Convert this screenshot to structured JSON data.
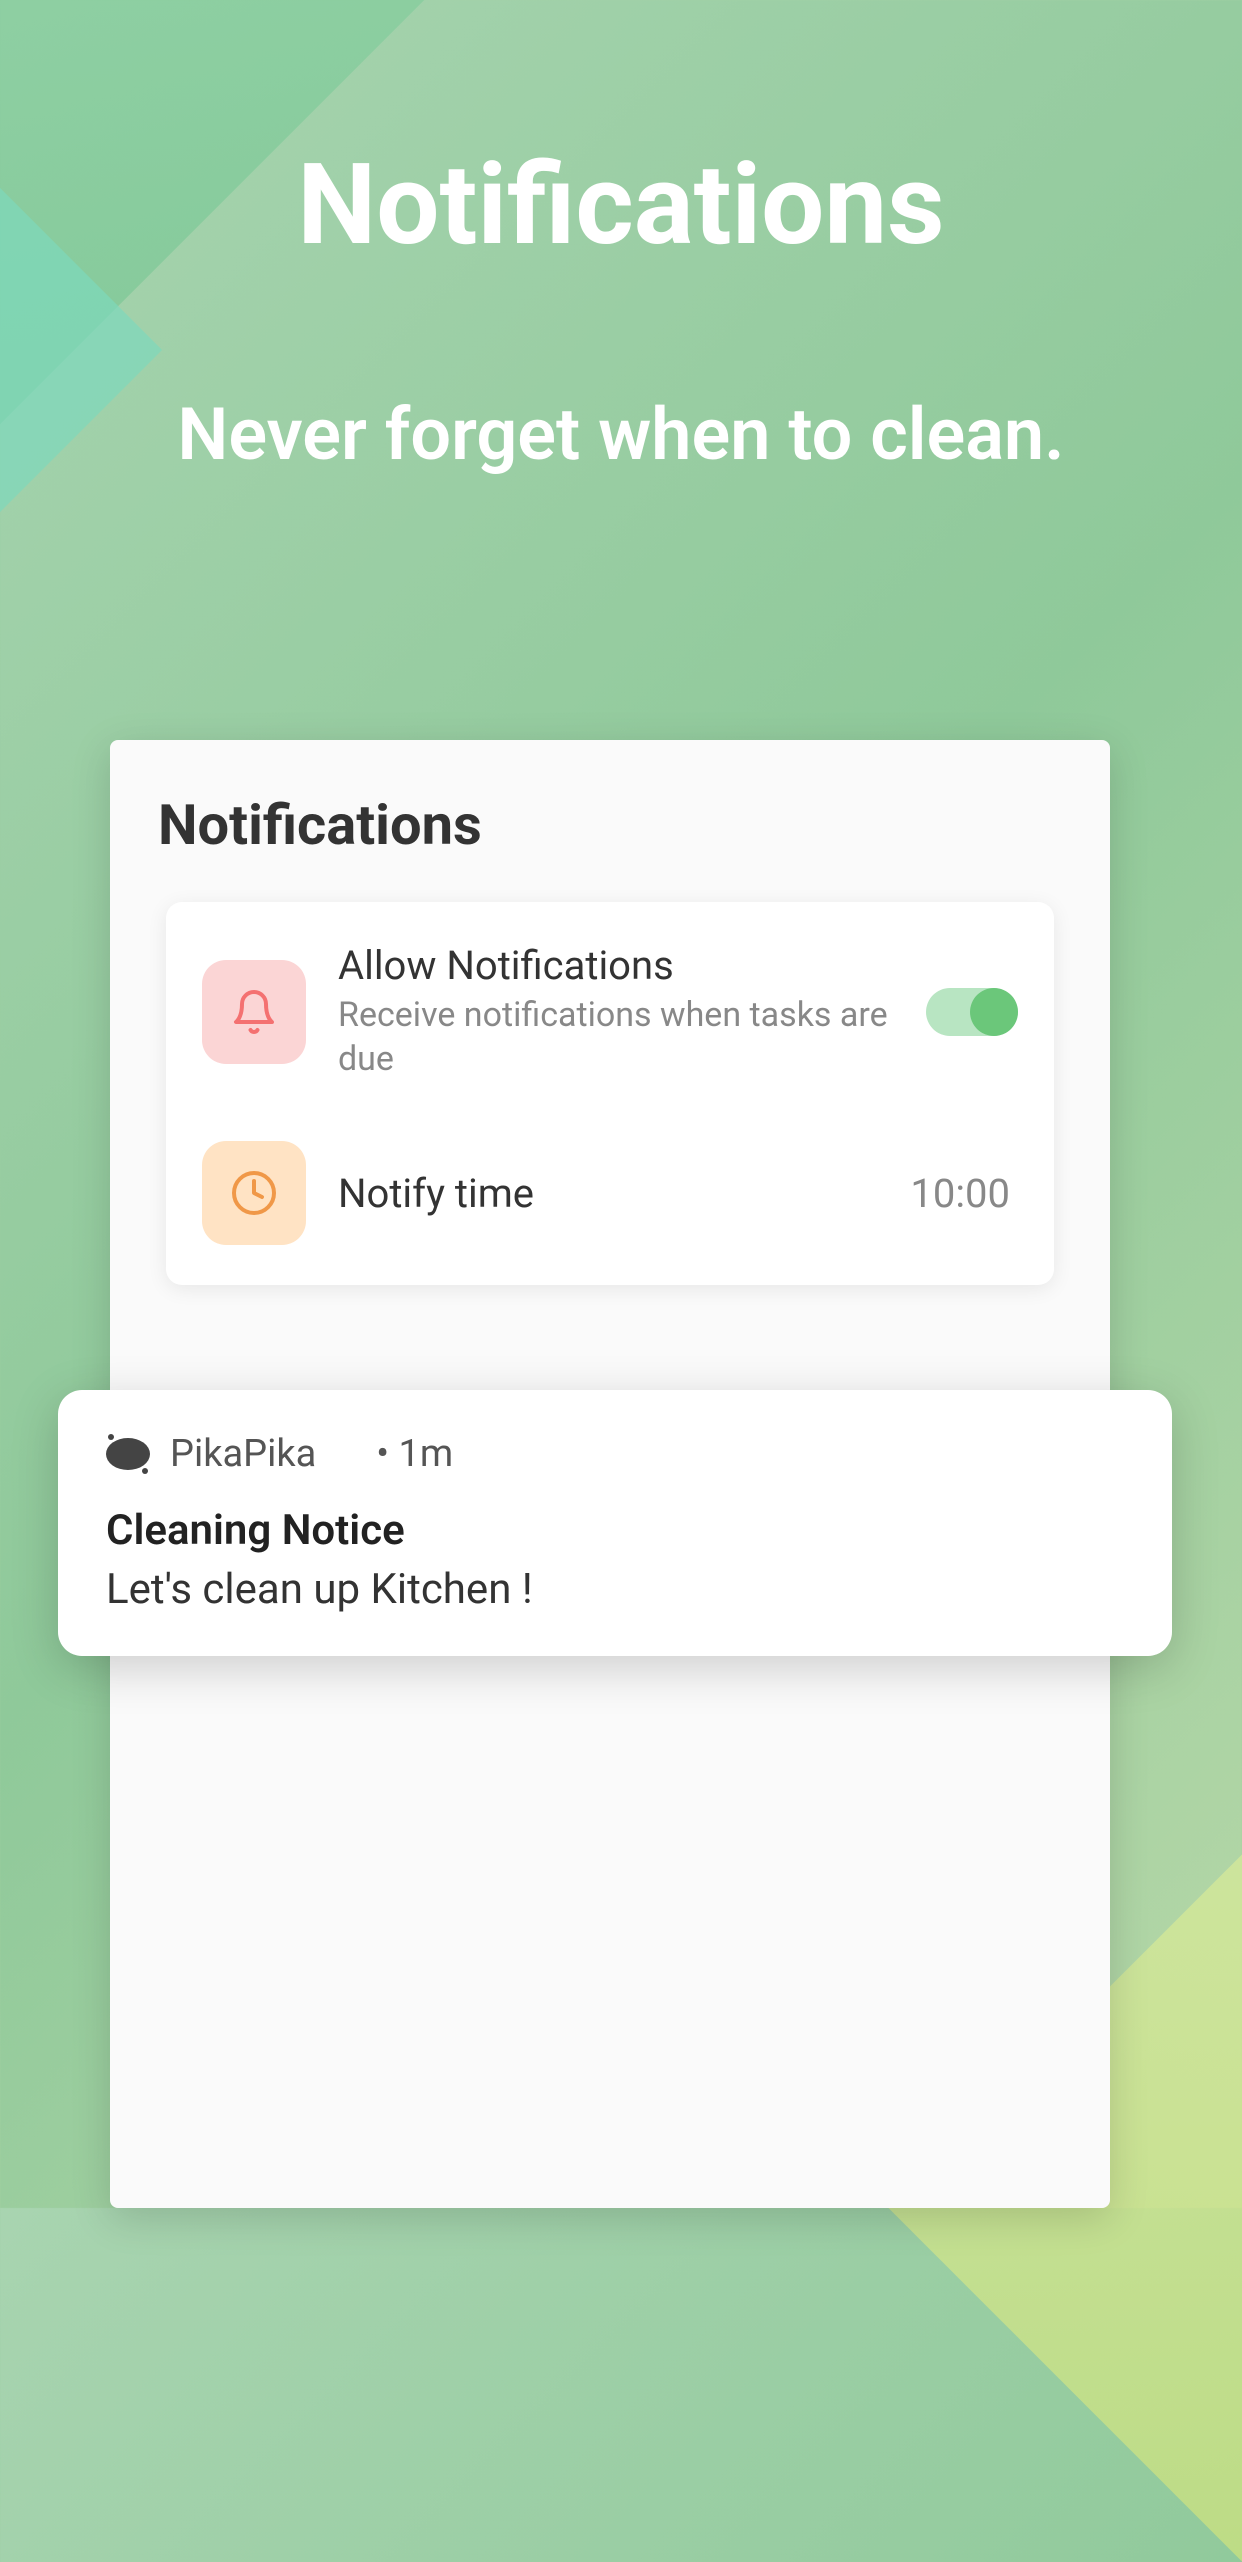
{
  "page": {
    "title": "Notifications",
    "subtitle": "Never forget when to clean."
  },
  "panel": {
    "title": "Notifications",
    "settings": {
      "allow": {
        "title": "Allow Notifications",
        "subtitle": "Receive notifications when tasks are due",
        "enabled": true,
        "icon": "bell-icon",
        "icon_color": "#f47171"
      },
      "notify_time": {
        "title": "Notify time",
        "value": "10:00",
        "icon": "clock-icon",
        "icon_color": "#f09848"
      }
    }
  },
  "notification": {
    "app_name": "PikaPika",
    "time": "• 1m",
    "title": "Cleaning Notice",
    "body": "Let's clean up Kitchen !"
  },
  "colors": {
    "background_green": "#8fc99a",
    "toggle_on": "#6bc77a",
    "white": "#ffffff"
  }
}
